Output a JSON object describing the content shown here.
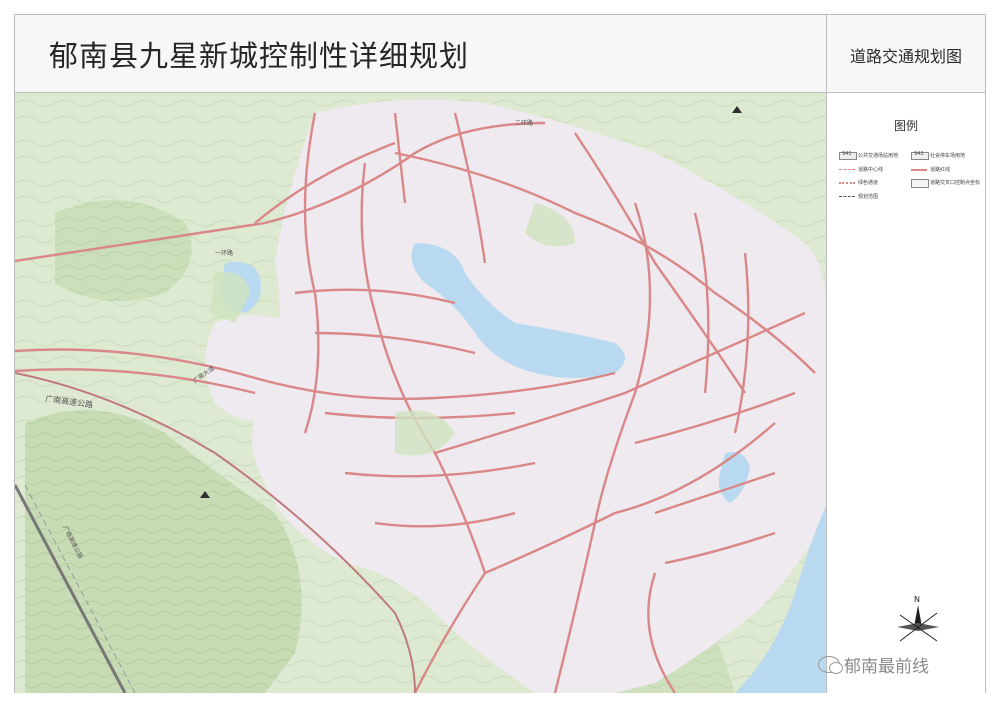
{
  "title": "郁南县九星新城控制性详细规划",
  "subtitle": "道路交通规划图",
  "legend": {
    "title": "图例",
    "items": [
      {
        "code": "S41",
        "label": "公共交通场站用地"
      },
      {
        "code": "S42",
        "label": "社会停车场用地"
      },
      {
        "label": "道路中心线"
      },
      {
        "label": "道路红线"
      },
      {
        "label": "绿色通道"
      },
      {
        "label": "道路交叉口控制点坐标"
      },
      {
        "label": "规划范围"
      }
    ]
  },
  "compass": {
    "north_label": "N"
  },
  "road_labels": [
    "广南高速公路",
    "广南大道",
    "一环路",
    "二环路",
    "广梧高速公路"
  ],
  "watermark": "郁南最前线",
  "colors": {
    "terrain": "#dbe9cd",
    "urban": "#eeeaef",
    "road_red": "#d98787",
    "water": "#b9d9f1"
  }
}
